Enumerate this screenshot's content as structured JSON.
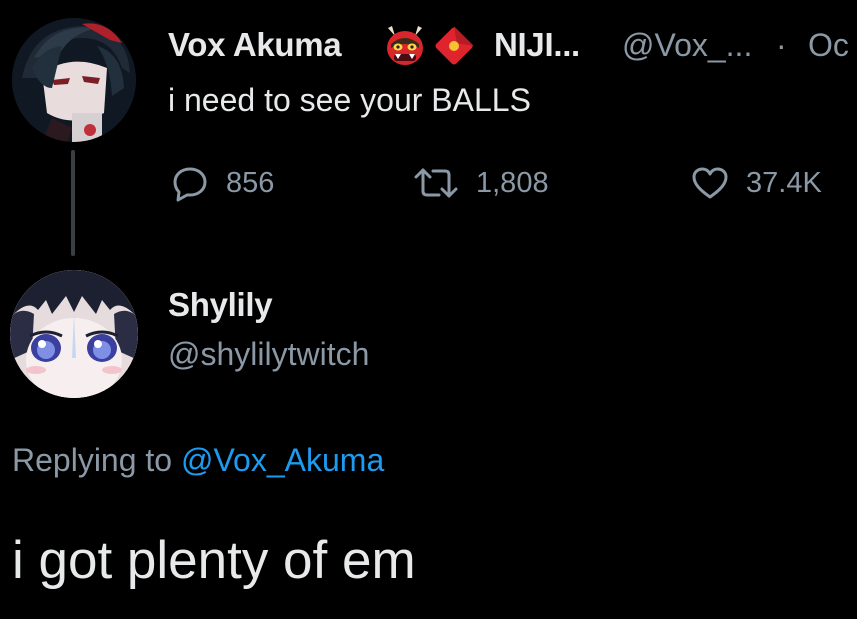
{
  "tweet1": {
    "author_name": "Vox Akuma",
    "badges": [
      "oni-mask-icon",
      "red-envelope-icon"
    ],
    "affiliation": "NIJI...",
    "handle": "@Vox_...",
    "separator": "·",
    "date": "Oc",
    "text": "i need to see your BALLS",
    "replies": "856",
    "retweets": "1,808",
    "likes": "37.4K"
  },
  "tweet2": {
    "author_name": "Shylily",
    "handle": "@shylilytwitch",
    "replying_prefix": "Replying to",
    "replying_to": "@Vox_Akuma",
    "text": "i got plenty of em"
  },
  "colors": {
    "background": "#000000",
    "primary_text": "#e7e9ea",
    "secondary_text": "#8b98a5",
    "link": "#1d9bf0",
    "thread_line": "#3a3f44"
  }
}
